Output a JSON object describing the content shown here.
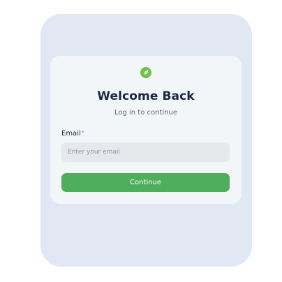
{
  "login": {
    "title": "Welcome Back",
    "subtitle": "Log in to continue",
    "email_label": "Email",
    "required_marker": "*",
    "email_placeholder": "Enter your email",
    "email_value": "",
    "continue_label": "Continue"
  },
  "icons": {
    "logo": "leaf-logo-icon"
  },
  "colors": {
    "accent": "#4eae5c",
    "logo": "#6cc24a",
    "title": "#1b2540",
    "panel_background": "#e2e8f3",
    "card_background": "#f3f6f9",
    "input_background": "#e6e9ec"
  }
}
